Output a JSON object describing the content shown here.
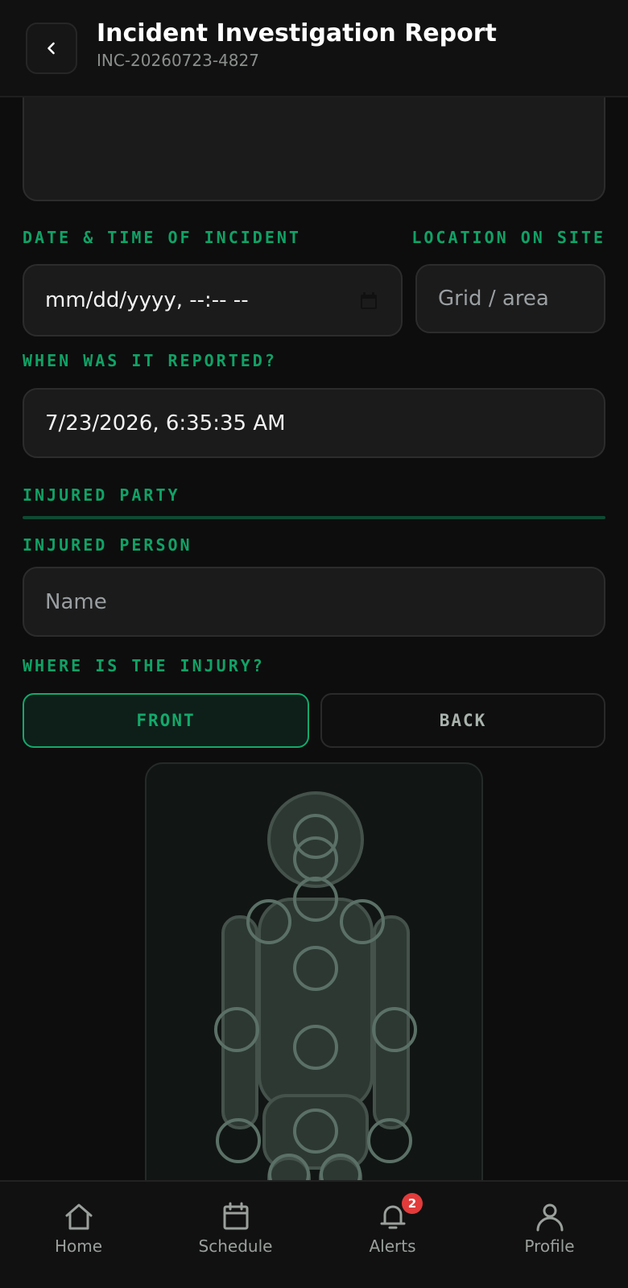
{
  "header": {
    "title": "Incident Investigation Report",
    "incident_id": "INC-20260723-4827"
  },
  "form": {
    "datetime_label": "DATE & TIME OF INCIDENT",
    "datetime_placeholder": "mm/dd/yyyy, --:-- --",
    "location_label": "LOCATION ON SITE",
    "location_placeholder": "Grid / area",
    "reported_label": "WHEN WAS IT REPORTED?",
    "reported_value": "7/23/2026, 6:35:35 AM",
    "section_injured": "INJURED PARTY",
    "injured_person_label": "INJURED PERSON",
    "injured_person_placeholder": "Name",
    "injury_location_label": "WHERE IS THE INJURY?",
    "view_front": "FRONT",
    "view_back": "BACK",
    "selected_view": "FRONT"
  },
  "nav": {
    "items": [
      {
        "label": "Home",
        "icon": "home-icon"
      },
      {
        "label": "Schedule",
        "icon": "calendar-icon"
      },
      {
        "label": "Alerts",
        "icon": "bell-icon",
        "badge": "2"
      },
      {
        "label": "Profile",
        "icon": "user-icon"
      }
    ]
  },
  "colors": {
    "accent": "#10a266",
    "background": "#0d0d0d",
    "field": "#1b1b1b",
    "badge": "#e23b3b"
  }
}
